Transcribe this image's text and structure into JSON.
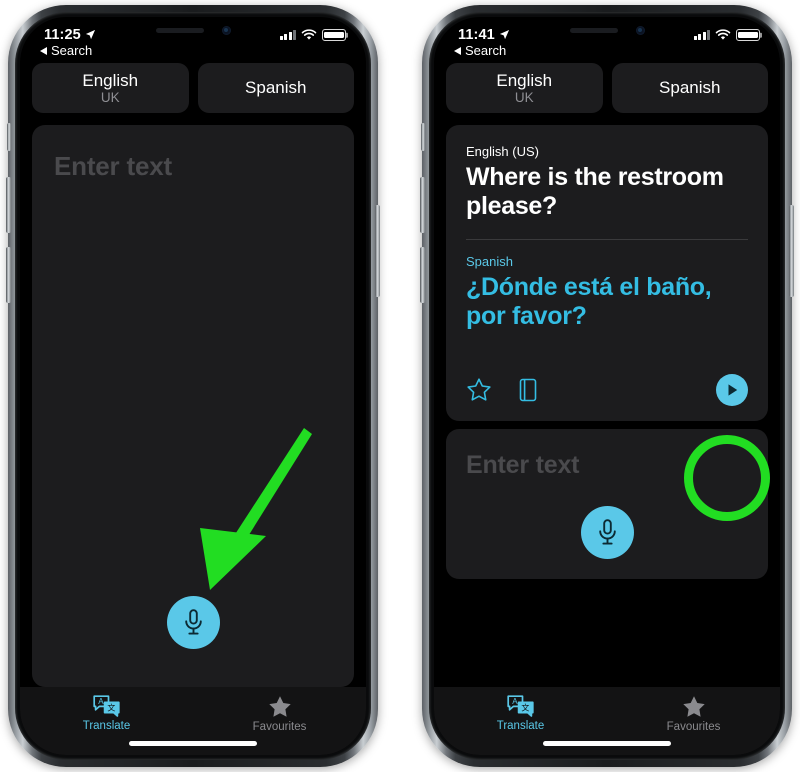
{
  "phones": [
    {
      "id": "left",
      "status": {
        "time": "11:25",
        "location_icon": "location-arrow-icon",
        "signal_icon": "cellular-signal-icon",
        "wifi_icon": "wifi-icon",
        "battery_icon": "battery-icon"
      },
      "back_link": {
        "label": "Search",
        "icon": "back-caret-icon"
      },
      "languages": {
        "source": {
          "name": "English",
          "region": "UK"
        },
        "target": {
          "name": "Spanish",
          "region": ""
        }
      },
      "input_card": {
        "placeholder": "Enter text",
        "mic_icon": "microphone-icon"
      },
      "tabs": [
        {
          "label": "Translate",
          "icon": "translate-icon",
          "active": true
        },
        {
          "label": "Favourites",
          "icon": "star-icon",
          "active": false
        }
      ]
    },
    {
      "id": "right",
      "status": {
        "time": "11:41",
        "location_icon": "location-arrow-icon",
        "signal_icon": "cellular-signal-icon",
        "wifi_icon": "wifi-icon",
        "battery_icon": "battery-icon"
      },
      "back_link": {
        "label": "Search",
        "icon": "back-caret-icon"
      },
      "languages": {
        "source": {
          "name": "English",
          "region": "UK"
        },
        "target": {
          "name": "Spanish",
          "region": ""
        }
      },
      "result_card": {
        "source_label": "English (US)",
        "source_text": "Where is the restroom please?",
        "target_label": "Spanish",
        "target_text": "¿Dónde está el baño, por favor?",
        "actions": [
          {
            "name": "favourite",
            "icon": "star-outline-icon"
          },
          {
            "name": "dictionary",
            "icon": "book-icon"
          }
        ],
        "play_button": {
          "icon": "play-icon"
        }
      },
      "input_card": {
        "placeholder": "Enter text",
        "mic_icon": "microphone-icon"
      },
      "tabs": [
        {
          "label": "Translate",
          "icon": "translate-icon",
          "active": true
        },
        {
          "label": "Favourites",
          "icon": "star-icon",
          "active": false
        }
      ]
    }
  ],
  "annotations": {
    "arrow": {
      "name": "green-arrow-pointing-to-mic",
      "color": "#22dd22"
    },
    "ring": {
      "name": "green-highlight-ring-around-play",
      "color": "#22dd22"
    }
  },
  "colors": {
    "accent_cyan": "#5ac8e8",
    "translation_cyan": "#34bde3",
    "card_bg": "#1c1c1e",
    "screen_bg": "#000000",
    "annotation_green": "#22dd22",
    "secondary_text": "#8e8e93"
  }
}
